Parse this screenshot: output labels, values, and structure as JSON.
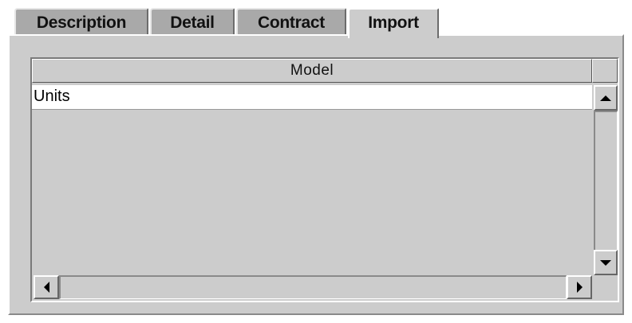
{
  "tabs": [
    {
      "label": "Description",
      "selected": false
    },
    {
      "label": "Detail",
      "selected": false
    },
    {
      "label": "Contract",
      "selected": false
    },
    {
      "label": "Import",
      "selected": true
    }
  ],
  "table": {
    "columns": [
      "Model"
    ],
    "rows": [
      {
        "model": "Units"
      }
    ]
  },
  "scrollbars": {
    "vertical": {
      "up_icon": "arrow-up-icon",
      "down_icon": "arrow-down-icon"
    },
    "horizontal": {
      "left_icon": "arrow-left-icon",
      "right_icon": "arrow-right-icon"
    }
  },
  "colors": {
    "panel": "#cccccc",
    "tab_unselected": "#a9a9a9",
    "row_selected_bg": "#ffffff"
  }
}
